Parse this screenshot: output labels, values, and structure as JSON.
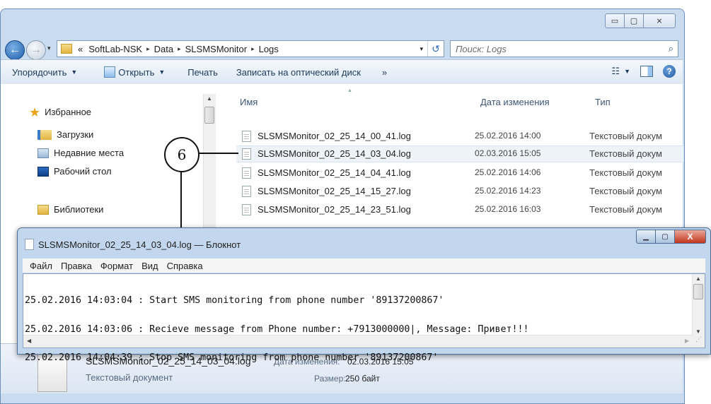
{
  "explorer": {
    "caption": {
      "minimize": "▭",
      "maximize": "▢",
      "close": "⨯"
    },
    "address": {
      "prefix": "«",
      "crumbs": [
        "SoftLab-NSK",
        "Data",
        "SLSMSMonitor",
        "Logs"
      ],
      "separator": "▸",
      "dropdown": "▾",
      "refresh": "↺"
    },
    "search": {
      "placeholder": "Поиск: Logs",
      "icon": "⌕"
    },
    "toolbar": {
      "organize": "Упорядочить",
      "open": "Открыть",
      "print": "Печать",
      "burn": "Записать на оптический диск",
      "more": "»",
      "views": "☷",
      "help": "?"
    },
    "nav": {
      "favorites": "Избранное",
      "downloads": "Загрузки",
      "recent": "Недавние места",
      "desktop": "Рабочий стол",
      "libraries": "Библиотеки"
    },
    "columns": {
      "name": "Имя",
      "date": "Дата изменения",
      "type": "Тип"
    },
    "files": [
      {
        "name": "SLSMSMonitor_02_25_14_00_41.log",
        "date": "25.02.2016 14:00",
        "type": "Текстовый докум"
      },
      {
        "name": "SLSMSMonitor_02_25_14_03_04.log",
        "date": "02.03.2016 15:05",
        "type": "Текстовый докум"
      },
      {
        "name": "SLSMSMonitor_02_25_14_04_41.log",
        "date": "25.02.2016 14:06",
        "type": "Текстовый докум"
      },
      {
        "name": "SLSMSMonitor_02_25_14_15_27.log",
        "date": "25.02.2016 14:23",
        "type": "Текстовый докум"
      },
      {
        "name": "SLSMSMonitor_02_25_14_23_51.log",
        "date": "25.02.2016 16:03",
        "type": "Текстовый докум"
      }
    ],
    "details": {
      "name": "SLSMSMonitor_02_25_14_03_04.log",
      "modified_label": "Дата изменения:",
      "modified_value": "02.03.2016 15:05",
      "type": "Текстовый документ",
      "size_label": "Размер:",
      "size_value": "250 байт"
    }
  },
  "callout": {
    "number": "6"
  },
  "notepad": {
    "title": "SLSMSMonitor_02_25_14_03_04.log — Блокнот",
    "menu": [
      "Файл",
      "Правка",
      "Формат",
      "Вид",
      "Справка"
    ],
    "lines": [
      "25.02.2016 14:03:04 : Start SMS monitoring from phone number '89137200867'",
      "25.02.2016 14:03:06 : Recieve message from Phone number: +7913000000|, Message: Привет!!!",
      "25.02.2016 14:04:39 : Stop SMS monitoring from phone number '89137200867'"
    ]
  }
}
